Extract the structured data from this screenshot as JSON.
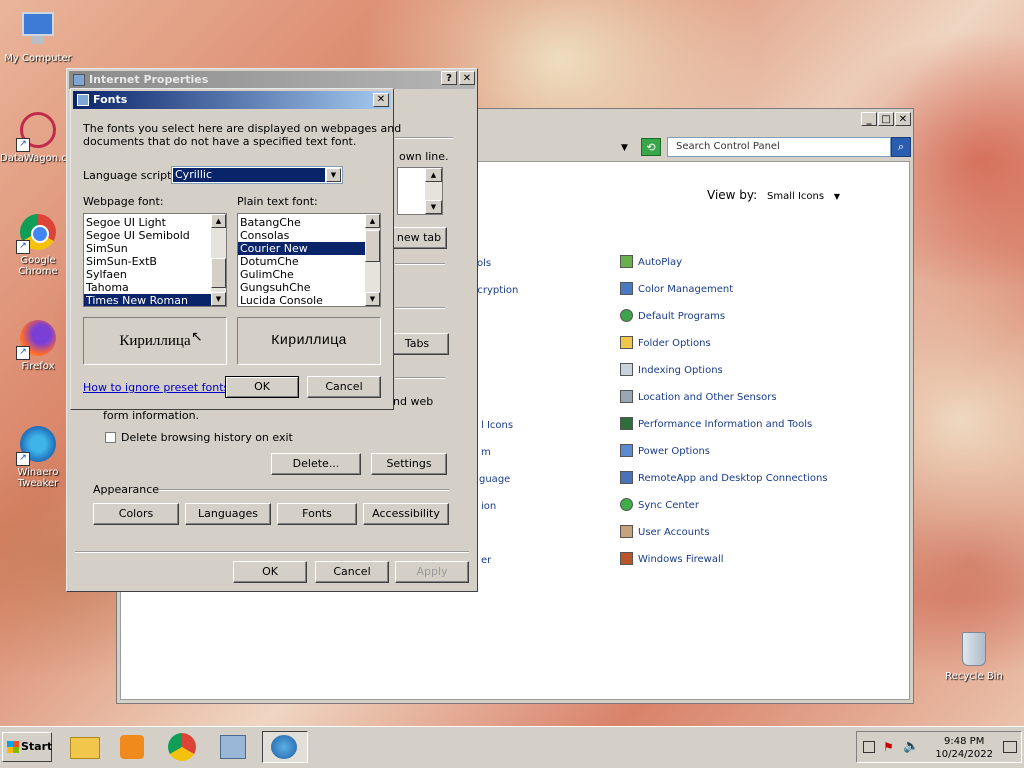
{
  "desktop": {
    "icons": [
      {
        "label": "My Computer"
      },
      {
        "label": "DataWagon.com"
      },
      {
        "label": "Google Chrome"
      },
      {
        "label": "Firefox"
      },
      {
        "label": "Winaero Tweaker"
      },
      {
        "label": "Recycle Bin"
      }
    ]
  },
  "control_panel": {
    "search_placeholder": "Search Control Panel",
    "view_by_label": "View by:",
    "view_by_value": "Small Icons",
    "left_fragments": [
      "ols",
      "ncryption",
      "l Icons",
      "m",
      "guage",
      "ion",
      "er"
    ],
    "items": [
      {
        "label": "AutoPlay"
      },
      {
        "label": "Color Management"
      },
      {
        "label": "Default Programs"
      },
      {
        "label": "Folder Options"
      },
      {
        "label": "Indexing Options"
      },
      {
        "label": "Location and Other Sensors"
      },
      {
        "label": "Performance Information and Tools"
      },
      {
        "label": "Power Options"
      },
      {
        "label": "RemoteApp and Desktop Connections"
      },
      {
        "label": "Sync Center"
      },
      {
        "label": "User Accounts"
      },
      {
        "label": "Windows Firewall"
      }
    ]
  },
  "internet_properties": {
    "title": "Internet Properties",
    "own_line_text": "own line.",
    "new_tab_button": "new tab",
    "tabs_button": "Tabs",
    "web_text": "nd web",
    "form_info_text": "form information.",
    "delete_history_label": "Delete browsing history on exit",
    "delete_button": "Delete...",
    "settings_button": "Settings",
    "appearance_label": "Appearance",
    "colors_button": "Colors",
    "languages_button": "Languages",
    "fonts_button": "Fonts",
    "accessibility_button": "Accessibility",
    "ok_button": "OK",
    "cancel_button": "Cancel",
    "apply_button": "Apply"
  },
  "fonts_dialog": {
    "title": "Fonts",
    "description_line1": "The fonts you select here are displayed on webpages and",
    "description_line2": "documents that do not have a specified text font.",
    "language_script_label": "Language script:",
    "language_script_value": "Cyrillic",
    "webpage_font_label": "Webpage font:",
    "plain_text_font_label": "Plain text font:",
    "webpage_fonts": [
      "Segoe UI Light",
      "Segoe UI Semibold",
      "SimSun",
      "SimSun-ExtB",
      "Sylfaen",
      "Tahoma",
      "Times New Roman"
    ],
    "webpage_selected": "Times New Roman",
    "plain_text_fonts": [
      "BatangChe",
      "Consolas",
      "Courier New",
      "DotumChe",
      "GulimChe",
      "GungsuhChe",
      "Lucida Console"
    ],
    "plain_text_selected": "Courier New",
    "preview_webpage": "Кириллица",
    "preview_plain": "Кириллица",
    "ignore_link": "How to ignore preset fonts",
    "ok_button": "OK",
    "cancel_button": "Cancel"
  },
  "taskbar": {
    "start_label": "Start",
    "time": "9:48 PM",
    "date": "10/24/2022"
  }
}
